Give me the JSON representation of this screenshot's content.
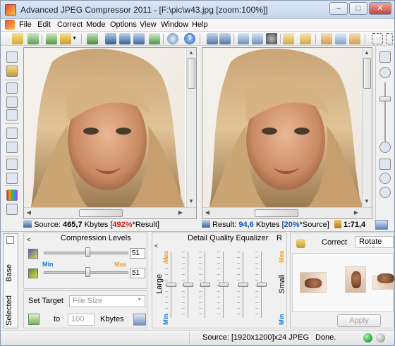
{
  "window": {
    "title": "Advanced JPEG Compressor 2011 - [F:\\pic\\w43.jpg  [zoom:100%]]",
    "min_label": "–",
    "max_label": "□",
    "close_label": "✕"
  },
  "menu": [
    {
      "label": "File",
      "key": "F"
    },
    {
      "label": "Edit",
      "key": "E"
    },
    {
      "label": "Correct",
      "key": "C"
    },
    {
      "label": "Mode",
      "key": "M"
    },
    {
      "label": "Options",
      "key": "O"
    },
    {
      "label": "View",
      "key": "V"
    },
    {
      "label": "Window",
      "key": "W"
    },
    {
      "label": "Help",
      "key": "H"
    }
  ],
  "status_left": {
    "prefix": "Source:",
    "size": "465,7",
    "unit": "Kbytes",
    "bracket_open": "[",
    "percent": "492%",
    "note": "*Result]"
  },
  "status_right": {
    "prefix": "Result:",
    "size": "94,6",
    "unit": "Kbytes",
    "bracket_open": "[",
    "percent": "20%",
    "note": "*Source]",
    "ratio": "1:71,4"
  },
  "tabs": {
    "base": "Base",
    "selected": "Selected"
  },
  "compression": {
    "title": "Compression Levels",
    "min_label": "Min",
    "max_label": "Max",
    "level1": "51",
    "level2": "51",
    "level1_fraction": 0.52,
    "level2_fraction": 0.52
  },
  "target": {
    "label": "Set Target",
    "select_value": "File Size",
    "to_label": "to",
    "value": "100",
    "unit": "Kbytes"
  },
  "equalizer": {
    "title": "Detail Quality Equalizer",
    "r_label": "R",
    "max_label": "Max",
    "min_label": "Min",
    "large_label": "Large",
    "small_label": "Small",
    "levels": [
      0.5,
      0.5,
      0.5,
      0.5,
      0.5,
      0.5
    ]
  },
  "correct": {
    "label": "Correct",
    "select_value": "Rotate",
    "apply_label": "Apply"
  },
  "statusbar": {
    "source_info": "Source: [1920x1200]x24 JPEG",
    "state": "Done."
  },
  "colors": {
    "accent_blue": "#1858b8",
    "percent_red": "#d01b10",
    "minmax_orange": "#f0a030",
    "led_green": "#34b34a"
  }
}
